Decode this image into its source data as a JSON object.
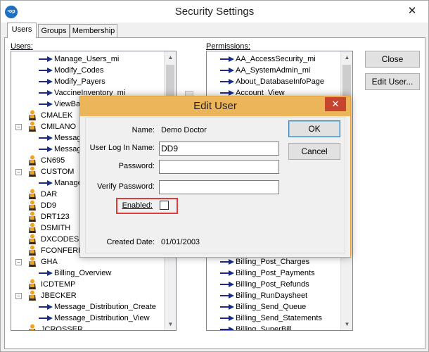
{
  "window": {
    "title": "Security Settings",
    "close_glyph": "✕",
    "app_icon_text": "•op"
  },
  "tabs": [
    {
      "label": "Users",
      "active": true
    },
    {
      "label": "Groups",
      "active": false
    },
    {
      "label": "Membership",
      "active": false
    }
  ],
  "users_panel": {
    "label": "Users:",
    "rows": [
      {
        "text": "Manage_Users_mi",
        "kind": "perm"
      },
      {
        "text": "Modify_Codes",
        "kind": "perm"
      },
      {
        "text": "Modify_Payers",
        "kind": "perm"
      },
      {
        "text": "VaccineInventory_mi",
        "kind": "perm"
      },
      {
        "text": "ViewBa",
        "kind": "perm"
      },
      {
        "text": "CMALEK",
        "kind": "user"
      },
      {
        "text": "CMILANO",
        "kind": "user",
        "expanded": true
      },
      {
        "text": "Messag",
        "kind": "perm"
      },
      {
        "text": "Messag",
        "kind": "perm"
      },
      {
        "text": "CN695",
        "kind": "user"
      },
      {
        "text": "CUSTOM",
        "kind": "user",
        "expanded": true
      },
      {
        "text": "Manage",
        "kind": "perm"
      },
      {
        "text": "DAR",
        "kind": "user"
      },
      {
        "text": "DD9",
        "kind": "user"
      },
      {
        "text": "DRT123",
        "kind": "user"
      },
      {
        "text": "DSMITH",
        "kind": "user"
      },
      {
        "text": "DXCODES",
        "kind": "user"
      },
      {
        "text": "FCONFERE",
        "kind": "user"
      },
      {
        "text": "GHA",
        "kind": "user",
        "expanded": true
      },
      {
        "text": "Billing_Overview",
        "kind": "perm"
      },
      {
        "text": "ICDTEMP",
        "kind": "user"
      },
      {
        "text": "JBECKER",
        "kind": "user",
        "expanded": true
      },
      {
        "text": "Message_Distribution_Create",
        "kind": "perm"
      },
      {
        "text": "Message_Distribution_View",
        "kind": "perm"
      },
      {
        "text": "JCROSSER",
        "kind": "user"
      }
    ]
  },
  "permissions_panel": {
    "label": "Permissions:",
    "rows_top": [
      "AA_AccessSecurity_mi",
      "AA_SystemAdmin_mi",
      "About_DatabaseInfoPage",
      "Account_View"
    ],
    "rows_bottom": [
      "Billing_Post_Charges",
      "Billing_Post_Payments",
      "Billing_Post_Refunds",
      "Billing_RunDaysheet",
      "Billing_Send_Queue",
      "Billing_Send_Statements",
      "Billing_SuperBill"
    ]
  },
  "buttons": {
    "close": "Close",
    "edit_user": "Edit User..."
  },
  "dialog": {
    "title": "Edit User",
    "close_glyph": "✕",
    "name_label": "Name:",
    "name_value": "Demo Doctor",
    "login_label": "User Log In Name:",
    "login_value": "DD9",
    "password_label": "Password:",
    "password_value": "",
    "verify_label": "Verify Password:",
    "verify_value": "",
    "enabled_label": "Enabled:",
    "enabled_checked": false,
    "created_label": "Created Date:",
    "created_value": "01/01/2003",
    "ok_label": "OK",
    "cancel_label": "Cancel"
  },
  "colors": {
    "arrow": "#1c2a8c",
    "person_head": "#f4a21a",
    "person_body": "#3a2a1a",
    "dialog_title": "#ecb55a",
    "dialog_close": "#c7442f",
    "highlight_box": "#e03c3c"
  }
}
